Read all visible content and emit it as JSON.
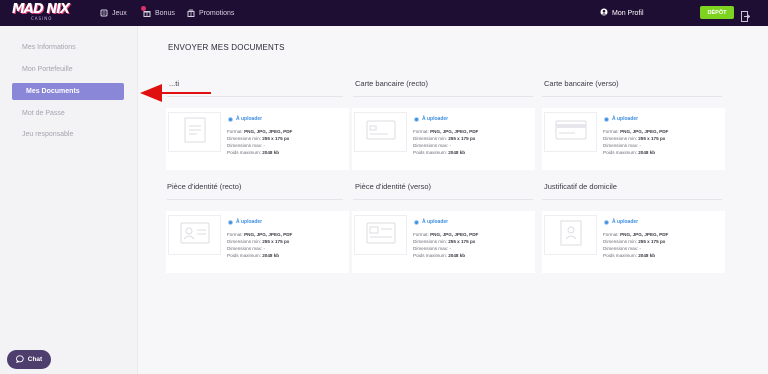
{
  "topbar": {
    "logo_text": "MAD NIX",
    "logo_sub": "CASINO",
    "nav": [
      {
        "label": "Jeux",
        "icon": "cards-icon"
      },
      {
        "label": "Bonus",
        "icon": "gift-icon"
      },
      {
        "label": "Promotions",
        "icon": "promo-icon"
      }
    ],
    "profile_label": "Mon Profil",
    "depot_label": "DÉPÔT"
  },
  "sidebar": {
    "items": [
      {
        "label": "Mes Informations",
        "active": false
      },
      {
        "label": "Mon Portefeuille",
        "active": false
      },
      {
        "label": "Mes Documents",
        "active": true
      },
      {
        "label": "Mot de Passe",
        "active": false
      },
      {
        "label": "Jeu responsable",
        "active": false
      }
    ],
    "chat_label": "Chat"
  },
  "main": {
    "title": "ENVOYER MES DOCUMENTS",
    "documents": [
      {
        "title": "...ti",
        "thumb": "doc-icon",
        "status": "À uploader",
        "format_label": "Format:",
        "format": "PNG, JPG, JPEG, PDF",
        "dim_min_label": "Dimensions min:",
        "dim_min": "255 x 175 px",
        "dim_max": "Dimensions max: -",
        "weight_label": "Poids maximum:",
        "weight": "2048 kb"
      },
      {
        "title": "Carte bancaire (recto)",
        "thumb": "card-front-icon",
        "status": "À uploader",
        "format_label": "Format:",
        "format": "PNG, JPG, JPEG, PDF",
        "dim_min_label": "Dimensions min:",
        "dim_min": "255 x 175 px",
        "dim_max": "Dimensions max: -",
        "weight_label": "Poids maximum:",
        "weight": "2048 kb"
      },
      {
        "title": "Carte bancaire (verso)",
        "thumb": "card-back-icon",
        "status": "À uploader",
        "format_label": "Format:",
        "format": "PNG, JPG, JPEG, PDF",
        "dim_min_label": "Dimensions min:",
        "dim_min": "255 x 175 px",
        "dim_max": "Dimensions max: -",
        "weight_label": "Poids maximum:",
        "weight": "2048 kb"
      },
      {
        "title": "Pièce d'identité (recto)",
        "thumb": "id-front-icon",
        "status": "À uploader",
        "format_label": "Format:",
        "format": "PNG, JPG, JPEG, PDF",
        "dim_min_label": "Dimensions min:",
        "dim_min": "255 x 175 px",
        "dim_max": "Dimensions max: -",
        "weight_label": "Poids maximum:",
        "weight": "2048 kb"
      },
      {
        "title": "Pièce d'identité (verso)",
        "thumb": "id-back-icon",
        "status": "À uploader",
        "format_label": "Format:",
        "format": "PNG, JPG, JPEG, PDF",
        "dim_min_label": "Dimensions min:",
        "dim_min": "255 x 175 px",
        "dim_max": "Dimensions max: -",
        "weight_label": "Poids maximum:",
        "weight": "2048 kb"
      },
      {
        "title": "Justificatif de domicile",
        "thumb": "address-doc-icon",
        "status": "À uploader",
        "format_label": "Format:",
        "format": "PNG, JPG, JPEG, PDF",
        "dim_min_label": "Dimensions min:",
        "dim_min": "255 x 175 px",
        "dim_max": "Dimensions max: -",
        "weight_label": "Poids maximum:",
        "weight": "2048 kb"
      }
    ]
  },
  "colors": {
    "topbar_bg": "#1e0e33",
    "active_item": "#8a86d8",
    "depot": "#7ed321",
    "status_blue": "#3d8fe0",
    "annotation_arrow": "#e01010"
  }
}
